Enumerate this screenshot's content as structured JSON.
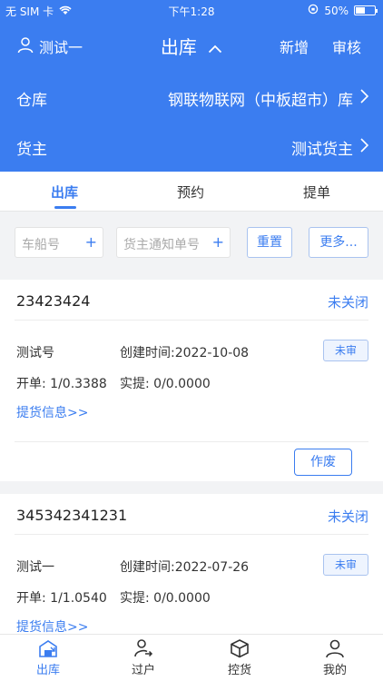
{
  "status_bar": {
    "carrier": "无 SIM 卡",
    "time": "下午1:28",
    "battery": "50%",
    "battery_level": 0.5
  },
  "header": {
    "user_name": "测试一",
    "title": "出库",
    "add_label": "新增",
    "audit_label": "审核"
  },
  "warehouse": {
    "label": "仓库",
    "value": "钢联物联网（中板超市）库"
  },
  "owner": {
    "label": "货主",
    "value": "测试货主"
  },
  "tabs": [
    {
      "label": "出库",
      "active": true
    },
    {
      "label": "预约",
      "active": false
    },
    {
      "label": "提单",
      "active": false
    }
  ],
  "filters": {
    "vessel_placeholder": "车船号",
    "notice_placeholder": "货主通知单号",
    "reset_label": "重置",
    "more_label": "更多..."
  },
  "cards": [
    {
      "number": "23423424",
      "state": "未关闭",
      "name": "测试号",
      "created": "创建时间:2022-10-08",
      "audit": "未审",
      "open": "开单: 1/0.3388",
      "actual": "实提: 0/0.0000",
      "link": "提货信息>>",
      "action": "作废"
    },
    {
      "number": "345342341231",
      "state": "未关闭",
      "name": "测试一",
      "created": "创建时间:2022-07-26",
      "audit": "未审",
      "open": "开单: 1/1.0540",
      "actual": "实提: 0/0.0000",
      "link": "提货信息>>"
    }
  ],
  "tabbar": [
    {
      "label": "出库",
      "icon": "warehouse-out-icon",
      "active": true
    },
    {
      "label": "过户",
      "icon": "transfer-user-icon",
      "active": false
    },
    {
      "label": "控货",
      "icon": "box-icon",
      "active": false
    },
    {
      "label": "我的",
      "icon": "profile-icon",
      "active": false
    }
  ],
  "colors": {
    "primary": "#3b7df0",
    "background": "#f2f3f5"
  }
}
